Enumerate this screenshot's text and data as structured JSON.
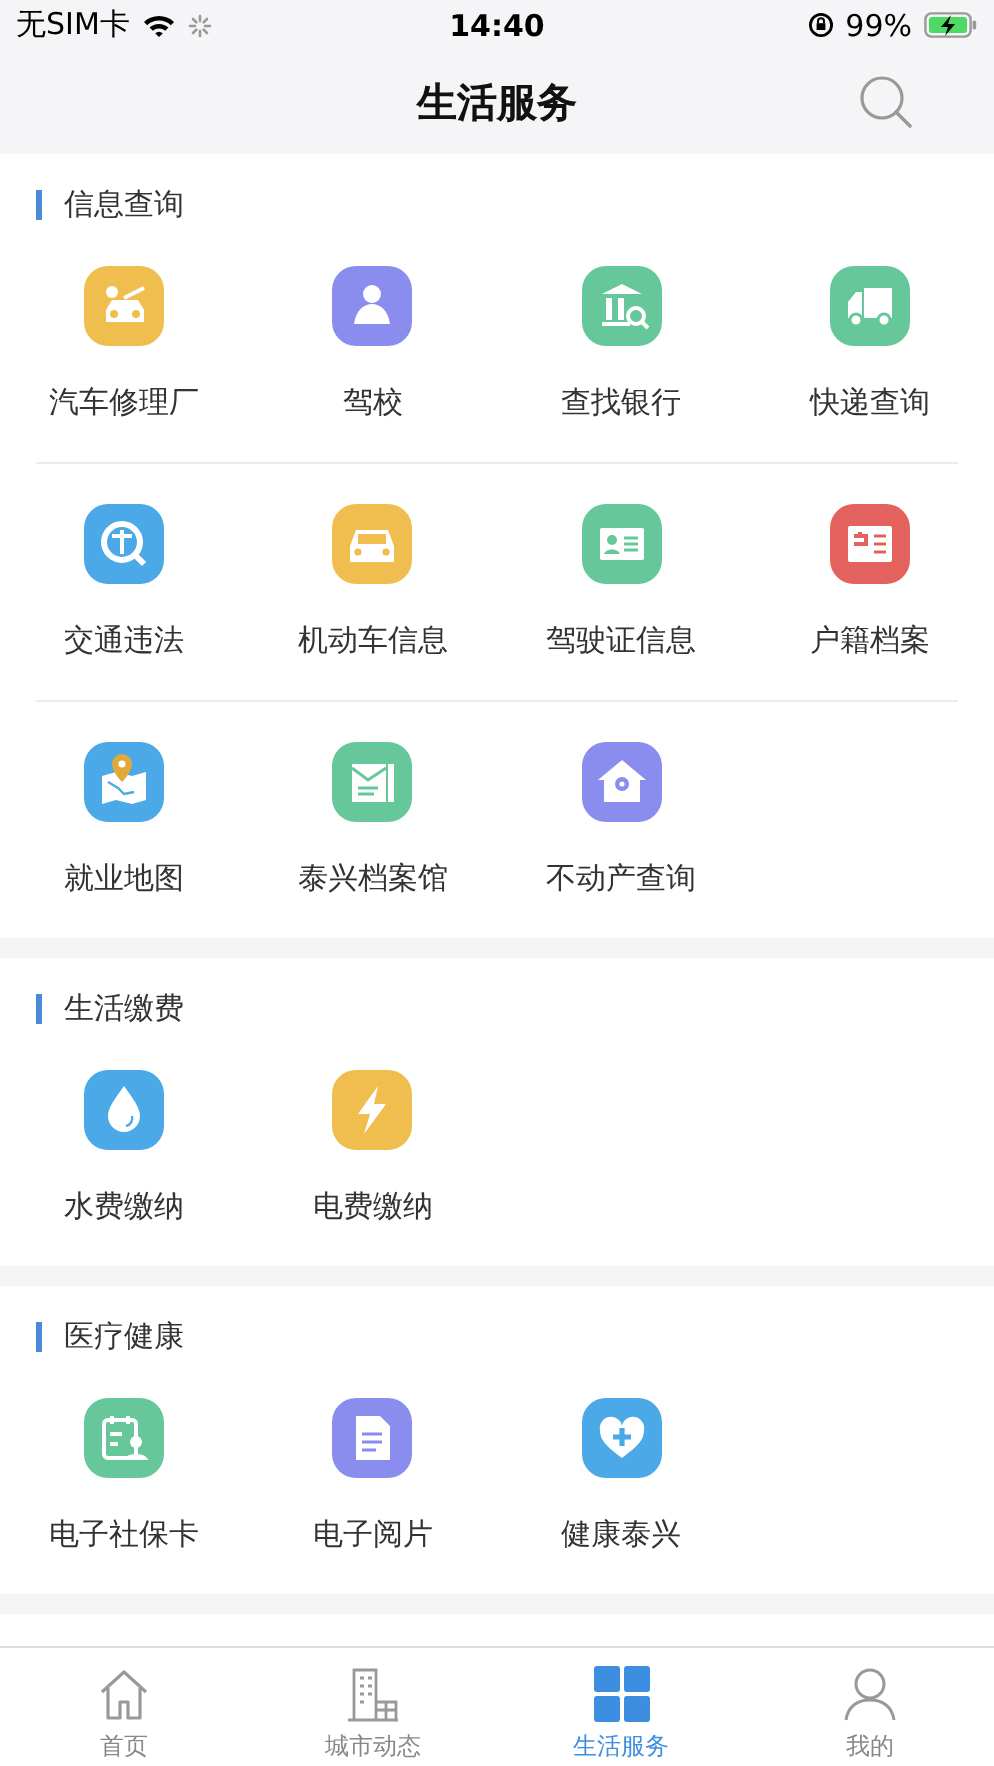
{
  "status_bar": {
    "carrier": "无SIM卡",
    "time": "14:40",
    "battery": "99%"
  },
  "nav": {
    "title": "生活服务"
  },
  "sections": [
    {
      "title": "信息查询",
      "items": [
        {
          "label": "汽车修理厂",
          "color": "#f0be4f"
        },
        {
          "label": "驾校",
          "color": "#8a8cee"
        },
        {
          "label": "查找银行",
          "color": "#66c89a"
        },
        {
          "label": "快递查询",
          "color": "#66c89a"
        },
        {
          "label": "交通违法",
          "color": "#4aa9e6"
        },
        {
          "label": "机动车信息",
          "color": "#f0be4f"
        },
        {
          "label": "驾驶证信息",
          "color": "#66c89a"
        },
        {
          "label": "户籍档案",
          "color": "#e4625d"
        },
        {
          "label": "就业地图",
          "color": "#4aa9e6"
        },
        {
          "label": "泰兴档案馆",
          "color": "#66c89a"
        },
        {
          "label": "不动产查询",
          "color": "#8a8cee"
        }
      ]
    },
    {
      "title": "生活缴费",
      "items": [
        {
          "label": "水费缴纳",
          "color": "#4aa9e6"
        },
        {
          "label": "电费缴纳",
          "color": "#f0be4f"
        }
      ]
    },
    {
      "title": "医疗健康",
      "items": [
        {
          "label": "电子社保卡",
          "color": "#66c89a"
        },
        {
          "label": "电子阅片",
          "color": "#8a8cee"
        },
        {
          "label": "健康泰兴",
          "color": "#4aa9e6"
        }
      ]
    }
  ],
  "tabs": [
    {
      "label": "首页",
      "selected": false
    },
    {
      "label": "城市动态",
      "selected": false
    },
    {
      "label": "生活服务",
      "selected": true
    },
    {
      "label": "我的",
      "selected": false
    }
  ]
}
